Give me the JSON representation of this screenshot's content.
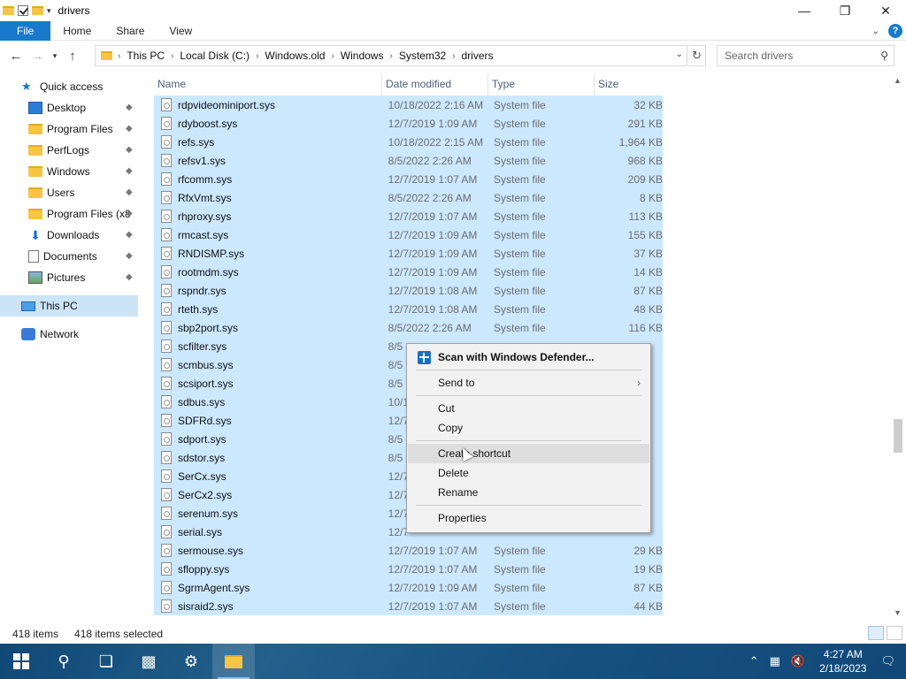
{
  "window": {
    "title": "drivers"
  },
  "ribbon": {
    "tabs": [
      "File",
      "Home",
      "Share",
      "View"
    ]
  },
  "address": {
    "crumbs": [
      "This PC",
      "Local Disk (C:)",
      "Windows.old",
      "Windows",
      "System32",
      "drivers"
    ],
    "search_placeholder": "Search drivers"
  },
  "nav": [
    {
      "label": "Quick access",
      "icon": "star-icon",
      "pinned": false,
      "kind": "top"
    },
    {
      "label": "Desktop",
      "icon": "desktop-icon",
      "pinned": true
    },
    {
      "label": "Program Files",
      "icon": "folder-icon",
      "pinned": true
    },
    {
      "label": "PerfLogs",
      "icon": "folder-icon",
      "pinned": true
    },
    {
      "label": "Windows",
      "icon": "folder-icon",
      "pinned": true
    },
    {
      "label": "Users",
      "icon": "folder-icon",
      "pinned": true
    },
    {
      "label": "Program Files (x8",
      "icon": "folder-icon",
      "pinned": true
    },
    {
      "label": "Downloads",
      "icon": "download-icon",
      "pinned": true
    },
    {
      "label": "Documents",
      "icon": "documents-icon",
      "pinned": true
    },
    {
      "label": "Pictures",
      "icon": "pictures-icon",
      "pinned": true
    },
    {
      "label": "This PC",
      "icon": "computer-icon",
      "pinned": false,
      "kind": "top",
      "selected": true
    },
    {
      "label": "Network",
      "icon": "network-icon",
      "pinned": false,
      "kind": "top"
    }
  ],
  "columns": {
    "name": "Name",
    "date": "Date modified",
    "type": "Type",
    "size": "Size"
  },
  "files": [
    {
      "name": "rdpvideominiport.sys",
      "date": "10/18/2022 2:16 AM",
      "type": "System file",
      "size": "32 KB"
    },
    {
      "name": "rdyboost.sys",
      "date": "12/7/2019 1:09 AM",
      "type": "System file",
      "size": "291 KB"
    },
    {
      "name": "refs.sys",
      "date": "10/18/2022 2:15 AM",
      "type": "System file",
      "size": "1,964 KB"
    },
    {
      "name": "refsv1.sys",
      "date": "8/5/2022 2:26 AM",
      "type": "System file",
      "size": "968 KB"
    },
    {
      "name": "rfcomm.sys",
      "date": "12/7/2019 1:07 AM",
      "type": "System file",
      "size": "209 KB"
    },
    {
      "name": "RfxVmt.sys",
      "date": "8/5/2022 2:26 AM",
      "type": "System file",
      "size": "8 KB"
    },
    {
      "name": "rhproxy.sys",
      "date": "12/7/2019 1:07 AM",
      "type": "System file",
      "size": "113 KB"
    },
    {
      "name": "rmcast.sys",
      "date": "12/7/2019 1:09 AM",
      "type": "System file",
      "size": "155 KB"
    },
    {
      "name": "RNDISMP.sys",
      "date": "12/7/2019 1:09 AM",
      "type": "System file",
      "size": "37 KB"
    },
    {
      "name": "rootmdm.sys",
      "date": "12/7/2019 1:09 AM",
      "type": "System file",
      "size": "14 KB"
    },
    {
      "name": "rspndr.sys",
      "date": "12/7/2019 1:08 AM",
      "type": "System file",
      "size": "87 KB"
    },
    {
      "name": "rteth.sys",
      "date": "12/7/2019 1:08 AM",
      "type": "System file",
      "size": "48 KB"
    },
    {
      "name": "sbp2port.sys",
      "date": "8/5/2022 2:26 AM",
      "type": "System file",
      "size": "116 KB"
    },
    {
      "name": "scfilter.sys",
      "date": "8/5",
      "type": "",
      "size": ""
    },
    {
      "name": "scmbus.sys",
      "date": "8/5",
      "type": "",
      "size": ""
    },
    {
      "name": "scsiport.sys",
      "date": "8/5",
      "type": "",
      "size": ""
    },
    {
      "name": "sdbus.sys",
      "date": "10/1",
      "type": "",
      "size": ""
    },
    {
      "name": "SDFRd.sys",
      "date": "12/7",
      "type": "",
      "size": ""
    },
    {
      "name": "sdport.sys",
      "date": "8/5",
      "type": "",
      "size": ""
    },
    {
      "name": "sdstor.sys",
      "date": "8/5",
      "type": "",
      "size": ""
    },
    {
      "name": "SerCx.sys",
      "date": "12/7",
      "type": "",
      "size": ""
    },
    {
      "name": "SerCx2.sys",
      "date": "12/7",
      "type": "",
      "size": ""
    },
    {
      "name": "serenum.sys",
      "date": "12/7",
      "type": "",
      "size": ""
    },
    {
      "name": "serial.sys",
      "date": "12/7",
      "type": "",
      "size": ""
    },
    {
      "name": "sermouse.sys",
      "date": "12/7/2019 1:07 AM",
      "type": "System file",
      "size": "29 KB"
    },
    {
      "name": "sfloppy.sys",
      "date": "12/7/2019 1:07 AM",
      "type": "System file",
      "size": "19 KB"
    },
    {
      "name": "SgrmAgent.sys",
      "date": "12/7/2019 1:09 AM",
      "type": "System file",
      "size": "87 KB"
    },
    {
      "name": "sisraid2.sys",
      "date": "12/7/2019 1:07 AM",
      "type": "System file",
      "size": "44 KB"
    }
  ],
  "context_menu": {
    "scan": "Scan with Windows Defender...",
    "send_to": "Send to",
    "cut": "Cut",
    "copy": "Copy",
    "create_shortcut": "Create shortcut",
    "delete": "Delete",
    "rename": "Rename",
    "properties": "Properties"
  },
  "status": {
    "count": "418 items",
    "selected": "418 items selected"
  },
  "taskbar": {
    "time": "4:27 AM",
    "date": "2/18/2023"
  },
  "colors": {
    "selection": "#cce8ff",
    "file_tab": "#1979ca",
    "context_bg": "#f2f2f2"
  }
}
